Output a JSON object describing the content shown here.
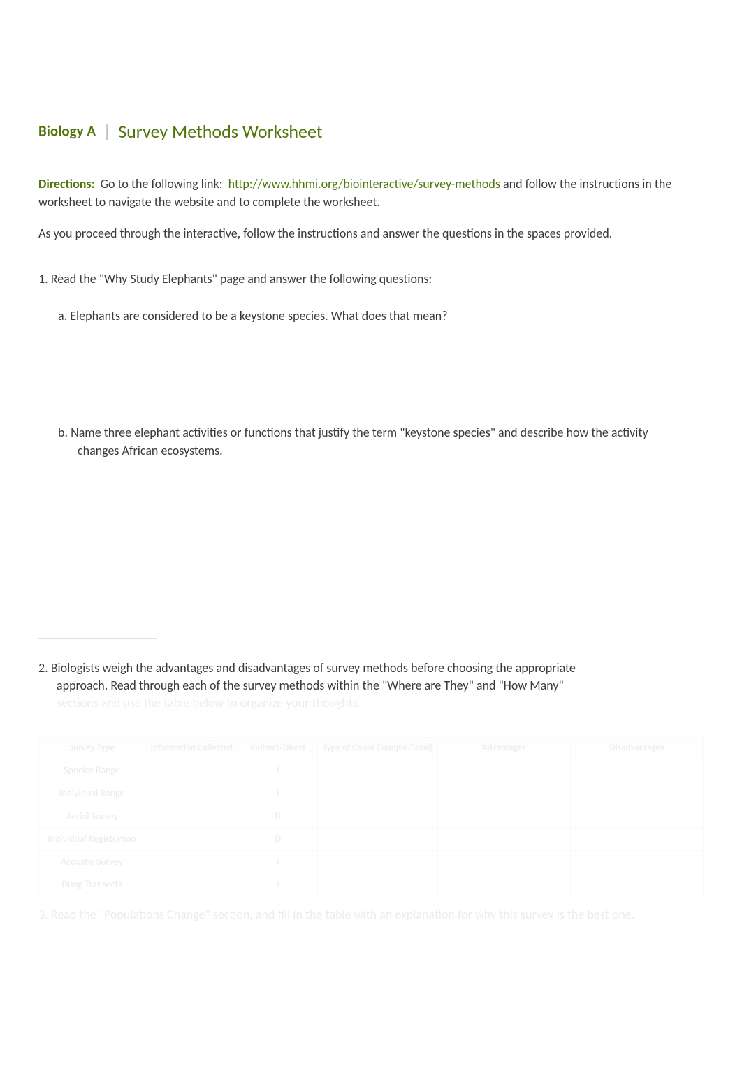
{
  "header": {
    "course": "Biology A",
    "title": "Survey Methods Worksheet"
  },
  "directions": {
    "label": "Directions:",
    "pre_link": "Go to the following link:",
    "link_text": "http://www.hhmi.org/biointeractive/survey-methods",
    "post_link": "and follow the instructions in the worksheet to navigate the website and to complete the worksheet.",
    "line2": "As you proceed through the interactive, follow the instructions and answer the questions in the spaces provided."
  },
  "questions": {
    "q1": "1.  Read the \"Why Study Elephants\" page and answer the following questions:",
    "q1a": "a.  Elephants are considered to be a keystone species. What does that mean?",
    "q1b_l1": "b. Name three elephant activities or functions that justify the term \"keystone species\" and describe how the activity",
    "q1b_l2": "changes African ecosystems.",
    "q2_l1": "2. Biologists weigh the advantages and disadvantages of survey methods before choosing the appropriate",
    "q2_l2": "approach. Read through each of the survey methods within the \"Where are They\" and \"How Many\"",
    "q2_l3_faded": "sections and use the table below to organize your thoughts.",
    "q3_faded": "3. Read the \"Populations Change\" section, and fill in the table with an explanation for why this survey is the best one."
  },
  "table": {
    "headers": [
      "Survey Type",
      "Information Collected",
      "Indirect/Direct",
      "Type of Count (Sample/Total)",
      "Advantages",
      "Disadvantages"
    ],
    "rows": [
      {
        "name": "Species Range",
        "type": "I"
      },
      {
        "name": "Individual Range",
        "type": "I"
      },
      {
        "name": "Aerial Survey",
        "type": "D"
      },
      {
        "name": "Individual Registration",
        "type": "D"
      },
      {
        "name": "Acoustic Survey",
        "type": "I"
      },
      {
        "name": "Dung Transects",
        "type": "I"
      }
    ]
  }
}
